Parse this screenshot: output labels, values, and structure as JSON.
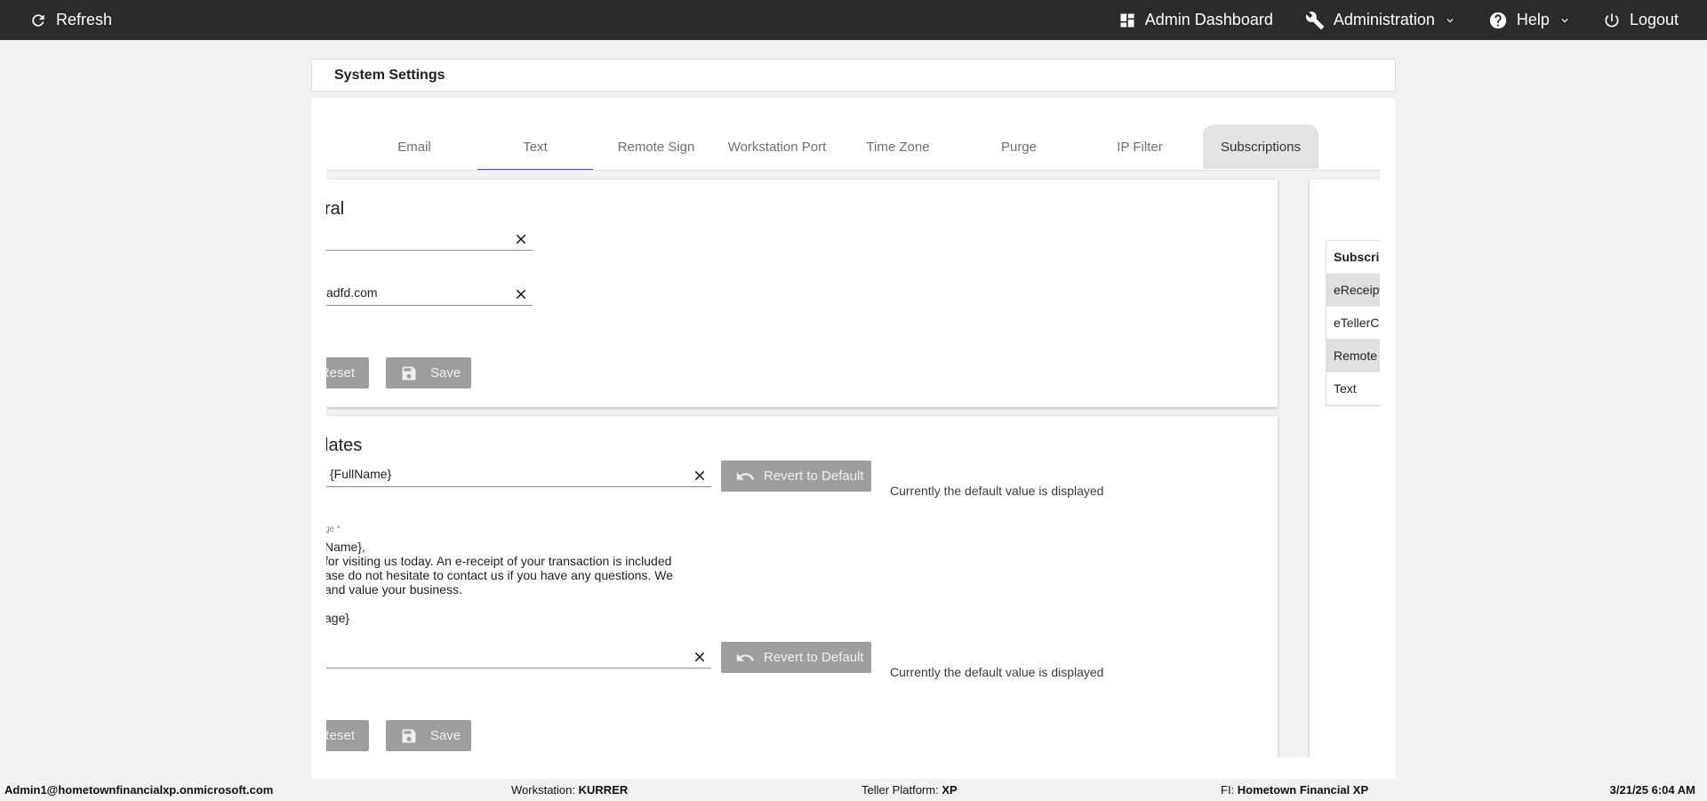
{
  "topbar": {
    "refresh": "Refresh",
    "admin_dashboard": "Admin Dashboard",
    "administration": "Administration",
    "help": "Help",
    "logout": "Logout"
  },
  "page_title": "System Settings",
  "tabs": [
    {
      "label": "Email"
    },
    {
      "label": "Text",
      "selected": true
    },
    {
      "label": "Remote Sign"
    },
    {
      "label": "Workstation Port"
    },
    {
      "label": "Time Zone"
    },
    {
      "label": "Purge"
    },
    {
      "label": "IP Filter"
    },
    {
      "label": "Subscriptions"
    }
  ],
  "general": {
    "title": "ral",
    "field1_value": "",
    "field2_value": "adfd.com",
    "reset_label": "Reset",
    "save_label": "Save"
  },
  "templates": {
    "title": "lates",
    "subject_value": "{FullName}",
    "revert_label": "Revert to Default",
    "default_note": "Currently the default value is displayed",
    "message_label": "ge *",
    "message_lines": [
      "Name},",
      "for visiting us today. An e-receipt of your transaction is included",
      "ase do not hesitate to contact us if you have any questions. We",
      " and value your business.",
      "",
      "age}"
    ],
    "field3_value": "",
    "revert2_label": "Revert to Default",
    "default_note2": "Currently the default value is displayed",
    "reset_label": "Reset",
    "save_label": "Save"
  },
  "subscriptions": {
    "header": "Subscrip",
    "rows": [
      "eReceipts",
      "eTellerCh",
      "Remote S",
      "Text"
    ]
  },
  "status": {
    "user": "Admin1@hometownfinancialxp.onmicrosoft.com",
    "workstation_label": "Workstation:",
    "workstation_value": "KURRER",
    "platform_label": "Teller Platform:",
    "platform_value": "XP",
    "fi_label": "FI:",
    "fi_value": "Hometown Financial XP",
    "datetime": "3/21/25 6:04 AM"
  }
}
